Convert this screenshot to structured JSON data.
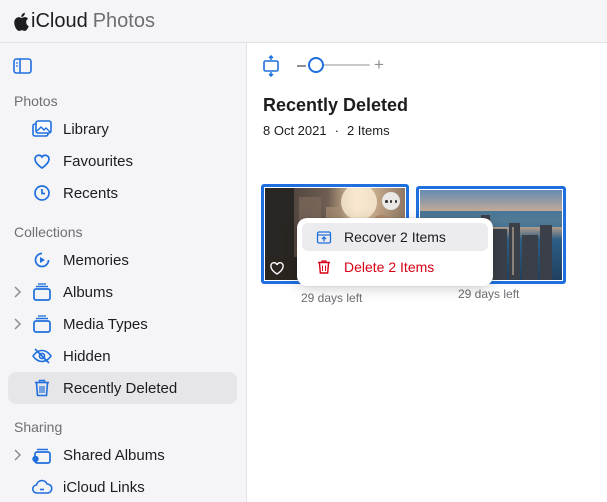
{
  "header": {
    "brand_main": "iCloud",
    "brand_sub": "Photos"
  },
  "sidebar": {
    "sections": {
      "photos": "Photos",
      "collections": "Collections",
      "sharing": "Sharing"
    },
    "items": [
      {
        "label": "Library",
        "icon": "library-icon"
      },
      {
        "label": "Favourites",
        "icon": "heart-icon"
      },
      {
        "label": "Recents",
        "icon": "clock-icon"
      },
      {
        "label": "Memories",
        "icon": "memories-icon"
      },
      {
        "label": "Albums",
        "icon": "albums-icon"
      },
      {
        "label": "Media Types",
        "icon": "media-types-icon"
      },
      {
        "label": "Hidden",
        "icon": "eye-slash-icon"
      },
      {
        "label": "Recently Deleted",
        "icon": "trash-icon",
        "active": true
      },
      {
        "label": "Shared Albums",
        "icon": "shared-albums-icon"
      },
      {
        "label": "iCloud Links",
        "icon": "cloud-link-icon"
      }
    ]
  },
  "main": {
    "title": "Recently Deleted",
    "date": "8 Oct 2021",
    "count": "2 Items",
    "zoom_plus": "+",
    "photos": [
      {
        "days_left": "29 days left"
      },
      {
        "days_left": "29 days left"
      }
    ],
    "context_menu": {
      "recover": "Recover 2 Items",
      "delete": "Delete 2 Items"
    }
  },
  "colors": {
    "accent": "#1f6fde",
    "destructive": "#d70015"
  }
}
